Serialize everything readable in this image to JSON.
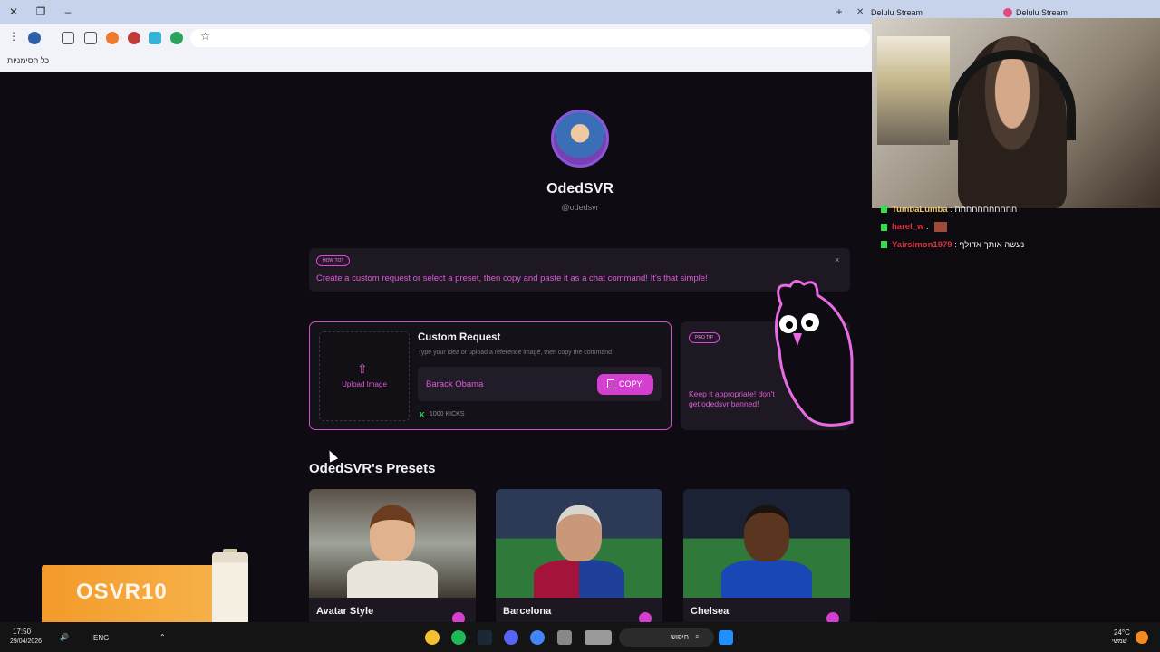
{
  "browser": {
    "tabs": [
      {
        "title": "Delulu Stream"
      },
      {
        "title": "Delulu Stream"
      }
    ],
    "bookmarks_label": "כל הסימניות"
  },
  "profile": {
    "name": "OdedSVR",
    "handle": "@odedsvr"
  },
  "howto": {
    "badge": "HOW TO?",
    "text": "Create a custom request or select a preset, then copy and paste it as a chat command! It's that simple!",
    "close": "×"
  },
  "custom_request": {
    "upload_label": "Upload Image",
    "title": "Custom Request",
    "subtitle": "Type your idea or upload a reference image, then copy the command",
    "input_value": "Barack Obama",
    "copy_label": "COPY",
    "kicks_icon": "K",
    "kicks": "1000 KICKS"
  },
  "protip": {
    "badge": "PRO TIP",
    "text": "Keep it appropriate! don't get odedsvr banned!"
  },
  "presets": {
    "title": "OdedSVR's Presets",
    "items": [
      {
        "label": "Avatar Style"
      },
      {
        "label": "Barcelona"
      },
      {
        "label": "Chelsea"
      }
    ]
  },
  "chat": [
    {
      "user": "TumbaLumba",
      "message": ": חחחחחחחחחחח",
      "color": "#f0c96b"
    },
    {
      "user": "harel_w",
      "message": ":",
      "color": "#e0303a"
    },
    {
      "user": "Yairsimon1979",
      "message": ": נעשה אותך אדולף",
      "color": "#e0303a"
    }
  ],
  "promo": {
    "code": "OSVR10"
  },
  "taskbar": {
    "time": "17:50",
    "date": "29/04/2026",
    "lang": "ENG",
    "search_placeholder": "חיפוש",
    "weather_temp": "24°C",
    "weather_desc": "שמשי"
  },
  "colors": {
    "accent": "#d43fcf",
    "accent_text": "#e05bd9",
    "background": "#0e0c12",
    "kick_green": "#2fe04a"
  }
}
